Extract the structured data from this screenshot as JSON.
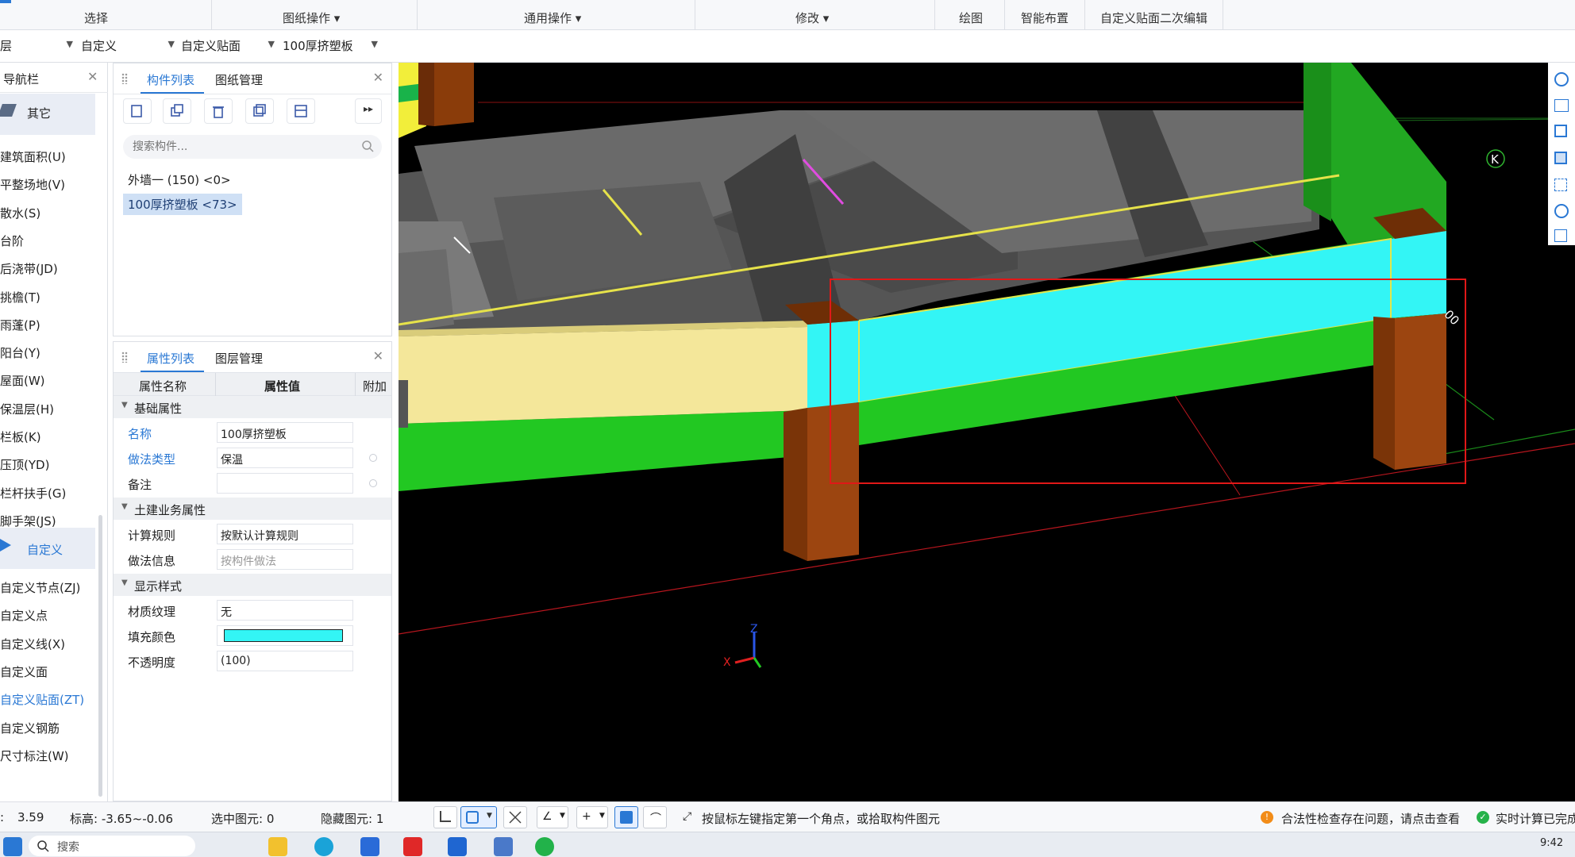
{
  "ribbon": {
    "groups": [
      "选择",
      "图纸操作",
      "通用操作",
      "修改",
      "绘图",
      "智能布置",
      "自定义贴面二次编辑"
    ]
  },
  "toolbar": {
    "floor": "层",
    "category": "自定义",
    "subcategory": "自定义贴面",
    "component": "100厚挤塑板"
  },
  "nav": {
    "title": "导航栏",
    "group_other": "其它",
    "items_other": [
      "建筑面积(U)",
      "平整场地(V)",
      "散水(S)",
      "台阶",
      "后浇带(JD)",
      "挑檐(T)",
      "雨蓬(P)",
      "阳台(Y)",
      "屋面(W)",
      "保温层(H)",
      "栏板(K)",
      "压顶(YD)",
      "栏杆扶手(G)",
      "脚手架(JS)"
    ],
    "group_custom": "自定义",
    "items_custom": [
      "自定义节点(ZJ)",
      "自定义点",
      "自定义线(X)",
      "自定义面",
      "自定义贴面(ZT)",
      "自定义钢筋",
      "尺寸标注(W)"
    ]
  },
  "component_panel": {
    "tabs": [
      "构件列表",
      "图纸管理"
    ],
    "search_placeholder": "搜索构件...",
    "items": [
      "外墙一 (150)  <0>",
      "100厚挤塑板 <73>"
    ]
  },
  "property_panel": {
    "tabs": [
      "属性列表",
      "图层管理"
    ],
    "headers": [
      "属性名称",
      "属性值",
      "附加"
    ],
    "groups": {
      "basic": "基础属性",
      "civil": "土建业务属性",
      "display": "显示样式"
    },
    "rows": {
      "name": {
        "label": "名称",
        "value": "100厚挤塑板"
      },
      "method_type": {
        "label": "做法类型",
        "value": "保温"
      },
      "remark": {
        "label": "备注",
        "value": ""
      },
      "calc_rule": {
        "label": "计算规则",
        "value": "按默认计算规则"
      },
      "method_info": {
        "label": "做法信息",
        "value": "按构件做法"
      },
      "texture": {
        "label": "材质纹理",
        "value": "无"
      },
      "fill_color": {
        "label": "填充颜色",
        "value": "#33f5f5"
      },
      "opacity": {
        "label": "不透明度",
        "value": "(100)"
      }
    }
  },
  "viewport": {
    "axis_label_k": "K",
    "dim_text": "00",
    "axis_x": "X",
    "axis_z": "Z"
  },
  "status": {
    "scale": "3.59",
    "elevation": "标高: -3.65~-0.06",
    "selected": "选中图元: 0",
    "hidden": "隐藏图元: 1",
    "hint": "按鼠标左键指定第一个角点，或拾取构件图元",
    "warning": "合法性检查存在问题，请点击查看",
    "realtime": "实时计算已完成"
  },
  "taskbar": {
    "search": "搜索",
    "time": "9:42"
  }
}
